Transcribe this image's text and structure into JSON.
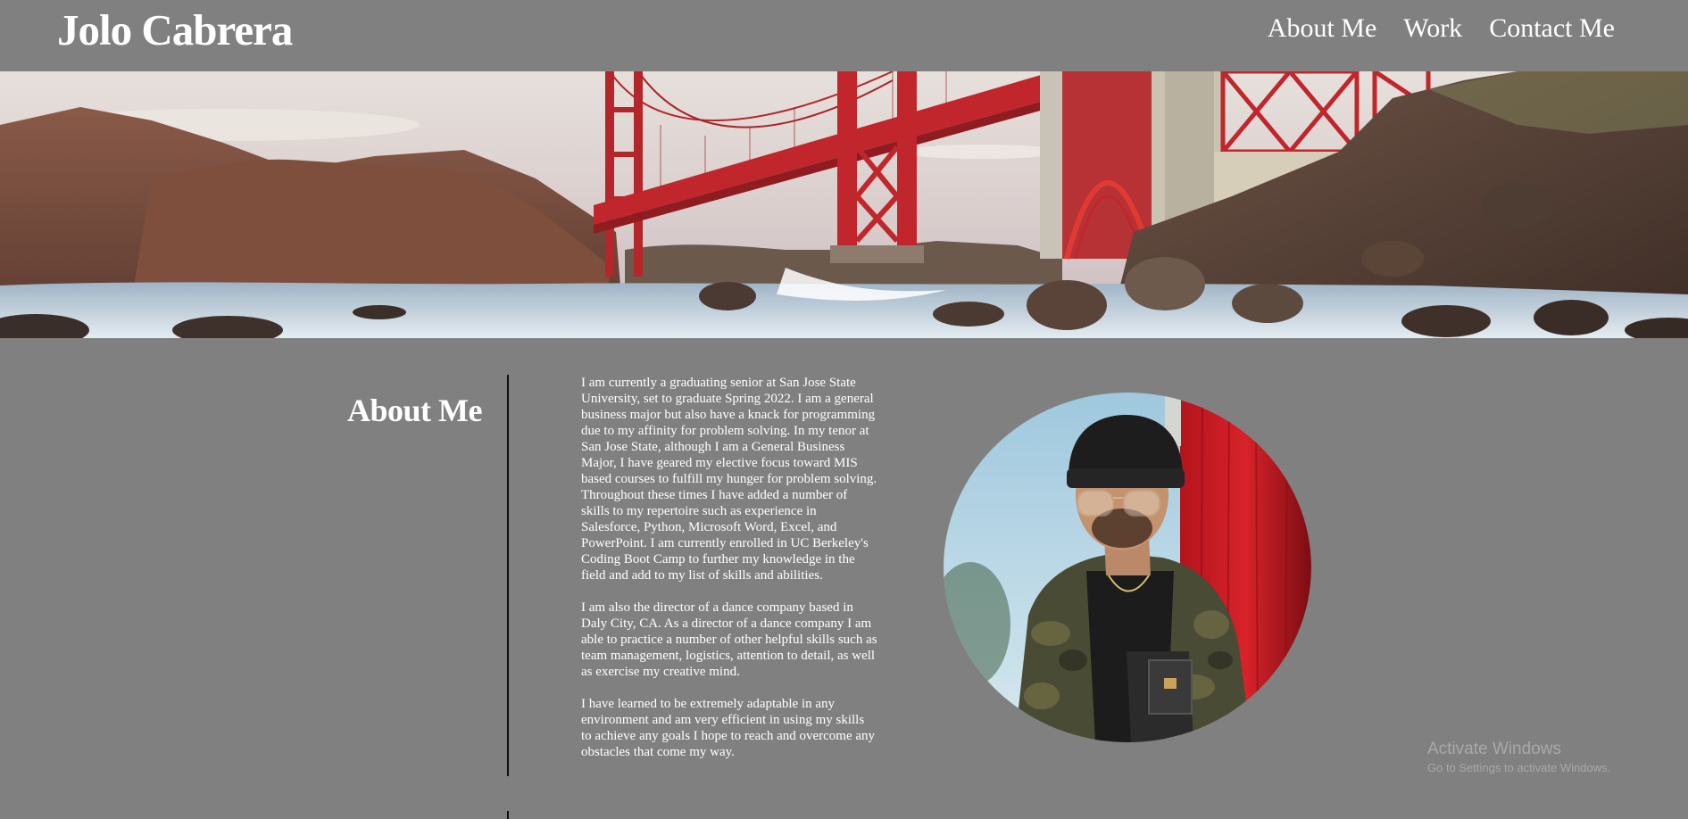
{
  "header": {
    "site_title": "Jolo Cabrera",
    "nav": [
      {
        "label": "About Me"
      },
      {
        "label": "Work"
      },
      {
        "label": "Contact Me"
      }
    ]
  },
  "hero": {
    "image": "golden-gate-bridge-banner"
  },
  "about": {
    "heading": "About Me",
    "paragraphs": [
      "I am currently a graduating senior at San Jose State University, set to graduate Spring 2022. I am a general business major but also have a knack for programming due to my affinity for problem solving. In my tenor at San Jose State, although I am a General Business Major, I have geared my elective focus toward MIS based courses to fulfill my hunger for problem solving. Throughout these times I have added a number of skills to my repertoire such as experience in Salesforce, Python, Microsoft Word, Excel, and PowerPoint. I am currently enrolled in UC Berkeley's Coding Boot Camp to further my knowledge in the field and add to my list of skills and abilities.",
      "I am also the director of a dance company based in Daly City, CA. As a director of a dance company I am able to practice a number of other helpful skills such as team management, logistics, attention to detail, as well as exercise my creative mind.",
      "I have learned to be extremely adaptable in any environment and am very efficient in using my skills to achieve any goals I hope to reach and overcome any obstacles that come my way."
    ],
    "photo": "profile-photo"
  },
  "watermark": {
    "title": "Activate Windows",
    "subtitle": "Go to Settings to activate Windows."
  },
  "colors": {
    "background": "#808080",
    "text": "#ffffff",
    "divider": "#111111",
    "bridge_red": "#c0262b"
  }
}
